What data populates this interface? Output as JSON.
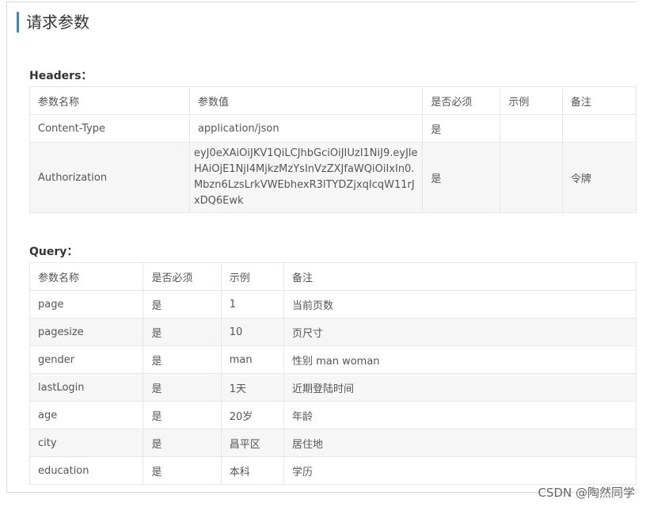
{
  "section_title": "请求参数",
  "headers": {
    "label": "Headers：",
    "columns": [
      "参数名称",
      "参数值",
      "是否必须",
      "示例",
      "备注"
    ],
    "rows": [
      [
        "Content-Type",
        "application/json",
        "是",
        "",
        ""
      ],
      [
        "Authorization",
        "eyJ0eXAiOiJKV1QiLCJhbGciOiJIUzI1NiJ9.eyJleHAiOjE1NjI4MjkzMzYsInVzZXJfaWQiOiIxIn0.Mbzn6LzsLrkVWEbhexR3lTYDZjxqIcqW11rJxDQ6Ewk",
        "是",
        "",
        "令牌"
      ]
    ]
  },
  "query": {
    "label": "Query：",
    "columns": [
      "参数名称",
      "是否必须",
      "示例",
      "备注"
    ],
    "rows": [
      [
        "page",
        "是",
        "1",
        "当前页数"
      ],
      [
        "pagesize",
        "是",
        "10",
        "页尺寸"
      ],
      [
        "gender",
        "是",
        "man",
        "性别 man woman"
      ],
      [
        "lastLogin",
        "是",
        "1天",
        "近期登陆时间"
      ],
      [
        "age",
        "是",
        "20岁",
        "年龄"
      ],
      [
        "city",
        "是",
        "昌平区",
        "居住地"
      ],
      [
        "education",
        "是",
        "本科",
        "学历"
      ]
    ]
  },
  "watermark": "CSDN @陶然同学"
}
